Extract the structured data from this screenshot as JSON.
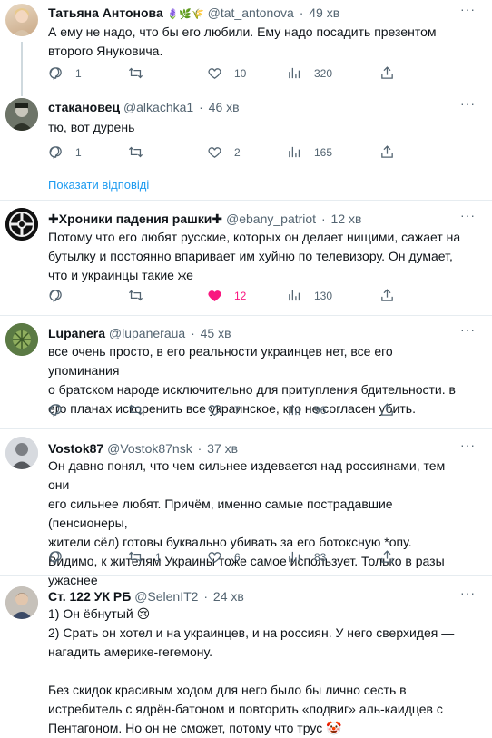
{
  "tweets": [
    {
      "name": "Татьяна Антонова",
      "handle": "@tat_antonova",
      "time": "49 хв",
      "name_emoji": "🪻🌿🌾",
      "lines": [
        "А ему не надо, что бы его любили. Ему надо посадить презентом",
        "второго Януковича."
      ],
      "replies": "1",
      "retweets": "",
      "likes": "10",
      "views": "320",
      "liked": false
    },
    {
      "name": "стакановец",
      "handle": "@alkachka1",
      "time": "46 хв",
      "lines": [
        "тю, вот дурень"
      ],
      "replies": "1",
      "retweets": "",
      "likes": "2",
      "views": "165",
      "liked": false
    },
    {
      "name": "✚Хроники падения рашки✚",
      "handle": "@ebany_patriot",
      "time": "12 хв",
      "lines": [
        "Потому что его любят русские, которых он делает нищими, сажает на",
        "бутылку и постоянно впаривает им хуйню по телевизору. Он думает,",
        "что и украинцы такие же"
      ],
      "replies": "",
      "retweets": "",
      "likes": "12",
      "views": "130",
      "liked": true
    },
    {
      "name": "Lupanera",
      "handle": "@lupaneraua",
      "time": "45 хв",
      "lines": [
        "все очень просто, в его реальности украинцев нет, все его упоминания",
        "о братском народе исключительно для притупления бдительности. в",
        "его планах искоренить все украинское, кто не согласен убить."
      ],
      "replies": "",
      "retweets": "",
      "likes": "7",
      "views": "96",
      "liked": false
    },
    {
      "name": "Vostok87",
      "handle": "@Vostok87nsk",
      "time": "37 хв",
      "lines": [
        "Он давно понял, что чем сильнее издевается над россиянами, тем они",
        "его сильнее любят. Причём, именно самые пострадавшие (пенсионеры,",
        "жители сёл) готовы буквально убивать за его ботоксную *опу.",
        "Видимо, к жителям Украины тоже самое использует. Только в разы",
        "ужаснее"
      ],
      "replies": "",
      "retweets": "1",
      "likes": "6",
      "views": "83",
      "liked": false
    },
    {
      "name": "Ст. 122 УК РБ",
      "handle": "@SelenIT2",
      "time": "24 хв",
      "lines": [
        "1) Он ёбнутый 😢",
        "2) Срать он хотел и на украинцев, и на россиян. У него сверхидея —",
        "нагадить америке-гегемону.",
        "",
        "Без скидок красивым ходом для него было бы лично сесть в",
        "истребитель с ядрён-батоном и повторить «подвиг» аль-каидцев с",
        "Пентагоном. Но он не сможет, потому что трус 🤡"
      ],
      "replies": "",
      "retweets": "",
      "likes": "",
      "views": "",
      "liked": false
    }
  ],
  "show_replies": "Показати відповіді",
  "icons": {
    "reply": "reply-icon",
    "retweet": "retweet-icon",
    "like": "heart-icon",
    "views": "views-icon",
    "share": "share-icon",
    "more": "more-icon"
  },
  "colors": {
    "accent": "#1d9bf0",
    "like": "#f91880",
    "muted": "#536471"
  }
}
